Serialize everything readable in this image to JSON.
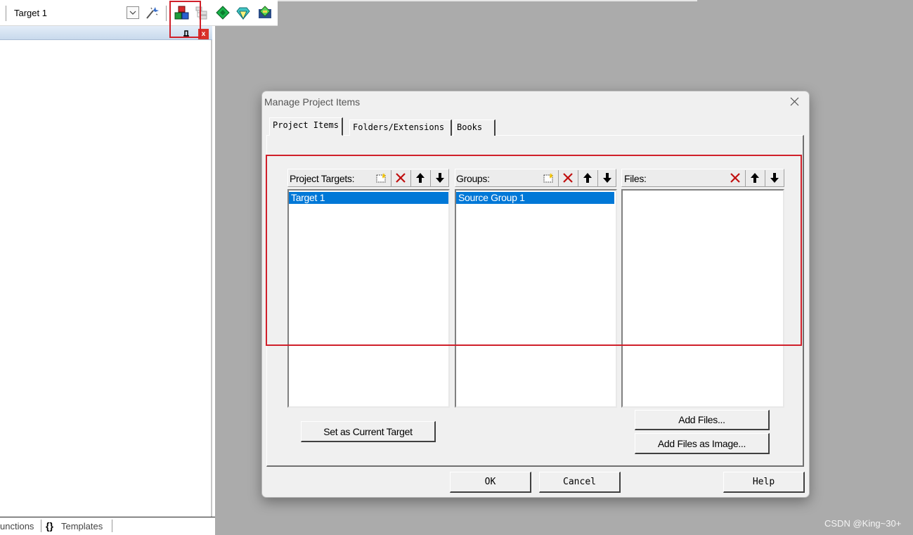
{
  "toolbar": {
    "target_value": "Target 1",
    "icons": [
      "dropdown-chevron-icon",
      "options-for-target-icon",
      "manage-project-items-icon",
      "select-packs-icon",
      "manage-runtime-environment-icon",
      "pack-installer-icon",
      "rte-diamond-icon"
    ]
  },
  "left_panel": {
    "tabs": [
      {
        "label": "unctions"
      },
      {
        "icon_glyph": "{}",
        "label": "Templates"
      }
    ],
    "close_glyph": "x"
  },
  "dialog": {
    "title": "Manage Project Items",
    "tabs": [
      {
        "label": "Project Items",
        "active": true
      },
      {
        "label": "Folders/Extensions",
        "active": false
      },
      {
        "label": "Books",
        "active": false
      }
    ],
    "project_targets": {
      "label": "Project Targets:",
      "items": [
        "Target 1"
      ],
      "selected": "Target 1"
    },
    "groups": {
      "label": "Groups:",
      "items": [
        "Source Group 1"
      ],
      "selected": "Source Group 1"
    },
    "files": {
      "label": "Files:",
      "items": []
    },
    "buttons": {
      "set_current": "Set as Current Target",
      "add_files": "Add Files...",
      "add_files_image": "Add Files as Image...",
      "ok": "OK",
      "cancel": "Cancel",
      "help": "Help"
    }
  },
  "watermark": "CSDN @King~30+",
  "colors": {
    "selection": "#0078d7",
    "highlight_box": "#d0202a",
    "desktop": "#ababab"
  }
}
